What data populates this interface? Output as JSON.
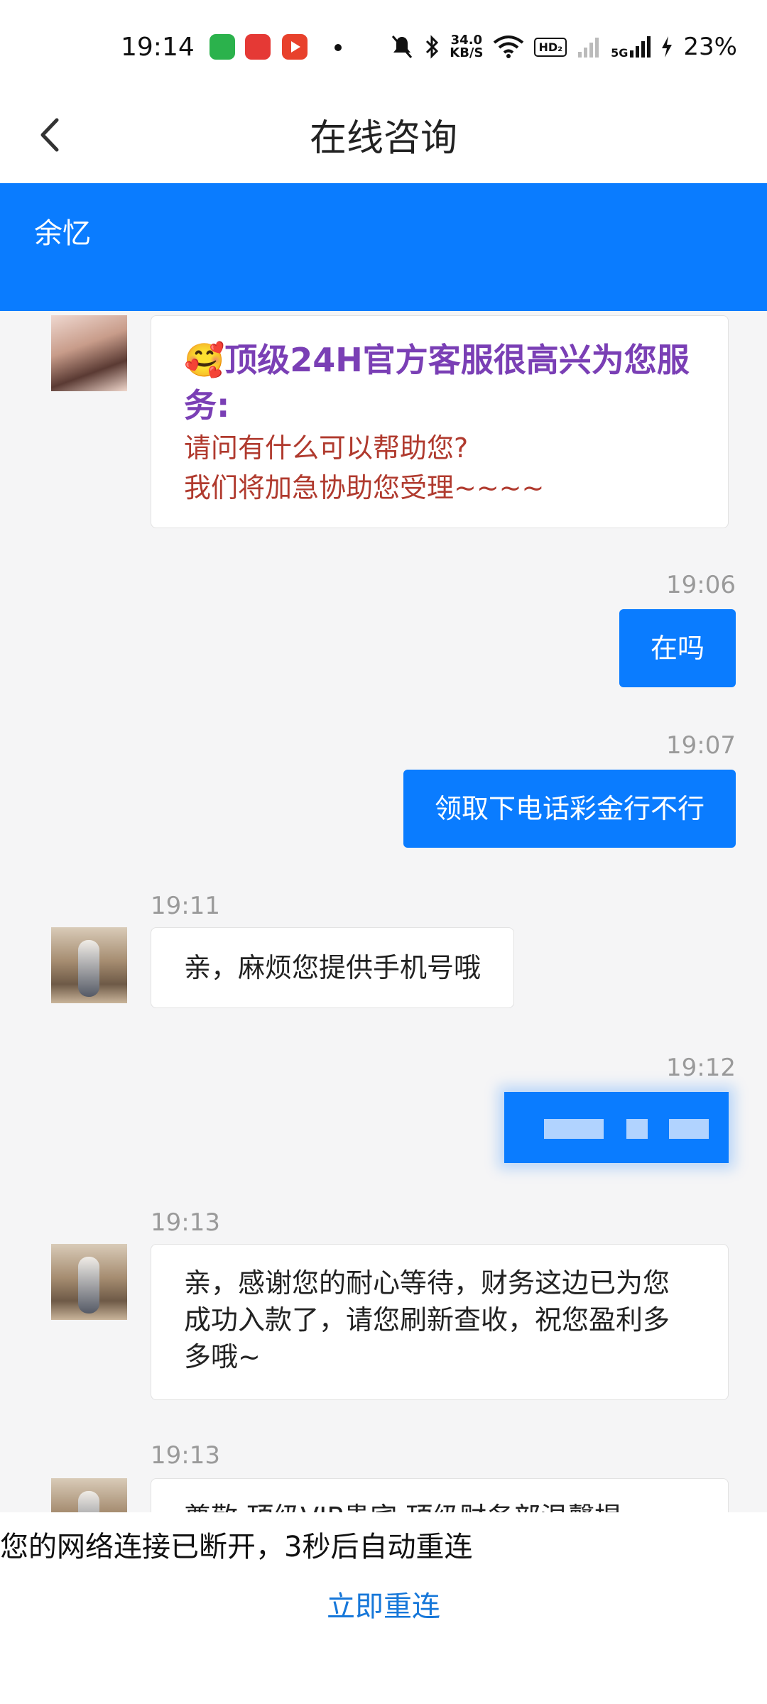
{
  "status_bar": {
    "time": "19:14",
    "net_speed_value": "34.0",
    "net_speed_unit": "KB/S",
    "hd_badge": "HD₂",
    "network": "5G",
    "battery": "23%"
  },
  "header": {
    "title": "在线咨询",
    "back_icon": "chevron-left-icon"
  },
  "banner": {
    "name": "余忆"
  },
  "messages": [
    {
      "direction": "in",
      "greeting_emoji": "🥰",
      "greeting_title": "顶级24H官方客服很高兴为您服务:",
      "greeting_line1": "请问有什么可以帮助您?",
      "greeting_line2": "我们将加急协助您受理~~~~"
    },
    {
      "direction": "out",
      "time": "19:06",
      "text": "在吗"
    },
    {
      "direction": "out",
      "time": "19:07",
      "text": "领取下电话彩金行不行"
    },
    {
      "direction": "in",
      "time": "19:11",
      "text": "亲，麻烦您提供手机号哦"
    },
    {
      "direction": "out",
      "time": "19:12",
      "text": ""
    },
    {
      "direction": "in",
      "time": "19:13",
      "text": "亲，感谢您的耐心等待，财务这边已为您成功入款了，请您刷新查收，祝您盈利多多哦~"
    },
    {
      "direction": "in",
      "time": "19:13",
      "text": "尊敬 顶级VIP贵宾 顶级财务部温馨提"
    }
  ],
  "network_notice": {
    "message": "您的网络连接已断开，3秒后自动重连",
    "reconnect_label": "立即重连"
  },
  "colors": {
    "accent": "#0a7cff",
    "greeting_title": "#7a3fb5",
    "greeting_body": "#b03a2e",
    "link": "#1677d9"
  }
}
